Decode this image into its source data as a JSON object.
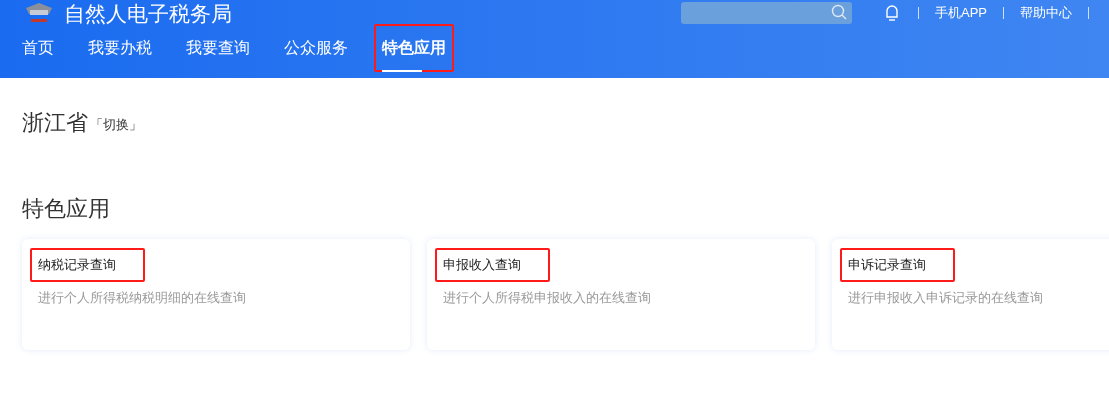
{
  "header": {
    "title": "自然人电子税务局",
    "links": [
      "手机APP",
      "帮助中心"
    ]
  },
  "nav": [
    {
      "label": "首页",
      "selected": false,
      "highlighted": false
    },
    {
      "label": "我要办税",
      "selected": false,
      "highlighted": false
    },
    {
      "label": "我要查询",
      "selected": false,
      "highlighted": false
    },
    {
      "label": "公众服务",
      "selected": false,
      "highlighted": false
    },
    {
      "label": "特色应用",
      "selected": true,
      "highlighted": true
    }
  ],
  "region": {
    "name": "浙江省",
    "switch": "「切换」"
  },
  "section_title": "特色应用",
  "cards": [
    {
      "title": "纳税记录查询",
      "description": "进行个人所得税纳税明细的在线查询",
      "highlighted": true
    },
    {
      "title": "申报收入查询",
      "description": "进行个人所得税申报收入的在线查询",
      "highlighted": true
    },
    {
      "title": "申诉记录查询",
      "description": "进行申报收入申诉记录的在线查询",
      "highlighted": true
    }
  ]
}
